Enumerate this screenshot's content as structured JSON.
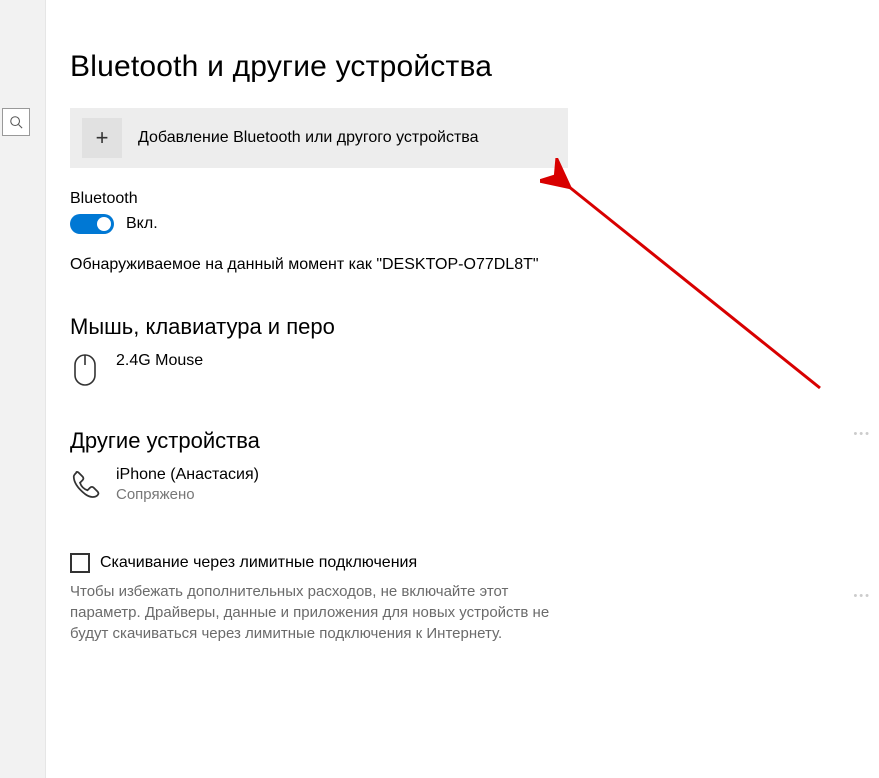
{
  "page": {
    "title": "Bluetooth и другие устройства"
  },
  "addDevice": {
    "label": "Добавление Bluetooth или другого устройства"
  },
  "bluetooth": {
    "label": "Bluetooth",
    "state": "Вкл.",
    "discoverable": "Обнаруживаемое на данный момент как \"DESKTOP-O77DL8T\""
  },
  "sections": {
    "mkp": "Мышь, клавиатура и перо",
    "other": "Другие устройства"
  },
  "devices": {
    "mouse": {
      "name": "2.4G Mouse"
    },
    "phone": {
      "name": "iPhone (Анастасия)",
      "status": "Сопряжено"
    }
  },
  "metered": {
    "label": "Скачивание через лимитные подключения",
    "hint": "Чтобы избежать дополнительных расходов, не включайте этот параметр. Драйверы, данные и приложения для новых устройств не будут скачиваться через лимитные подключения к Интернету."
  }
}
